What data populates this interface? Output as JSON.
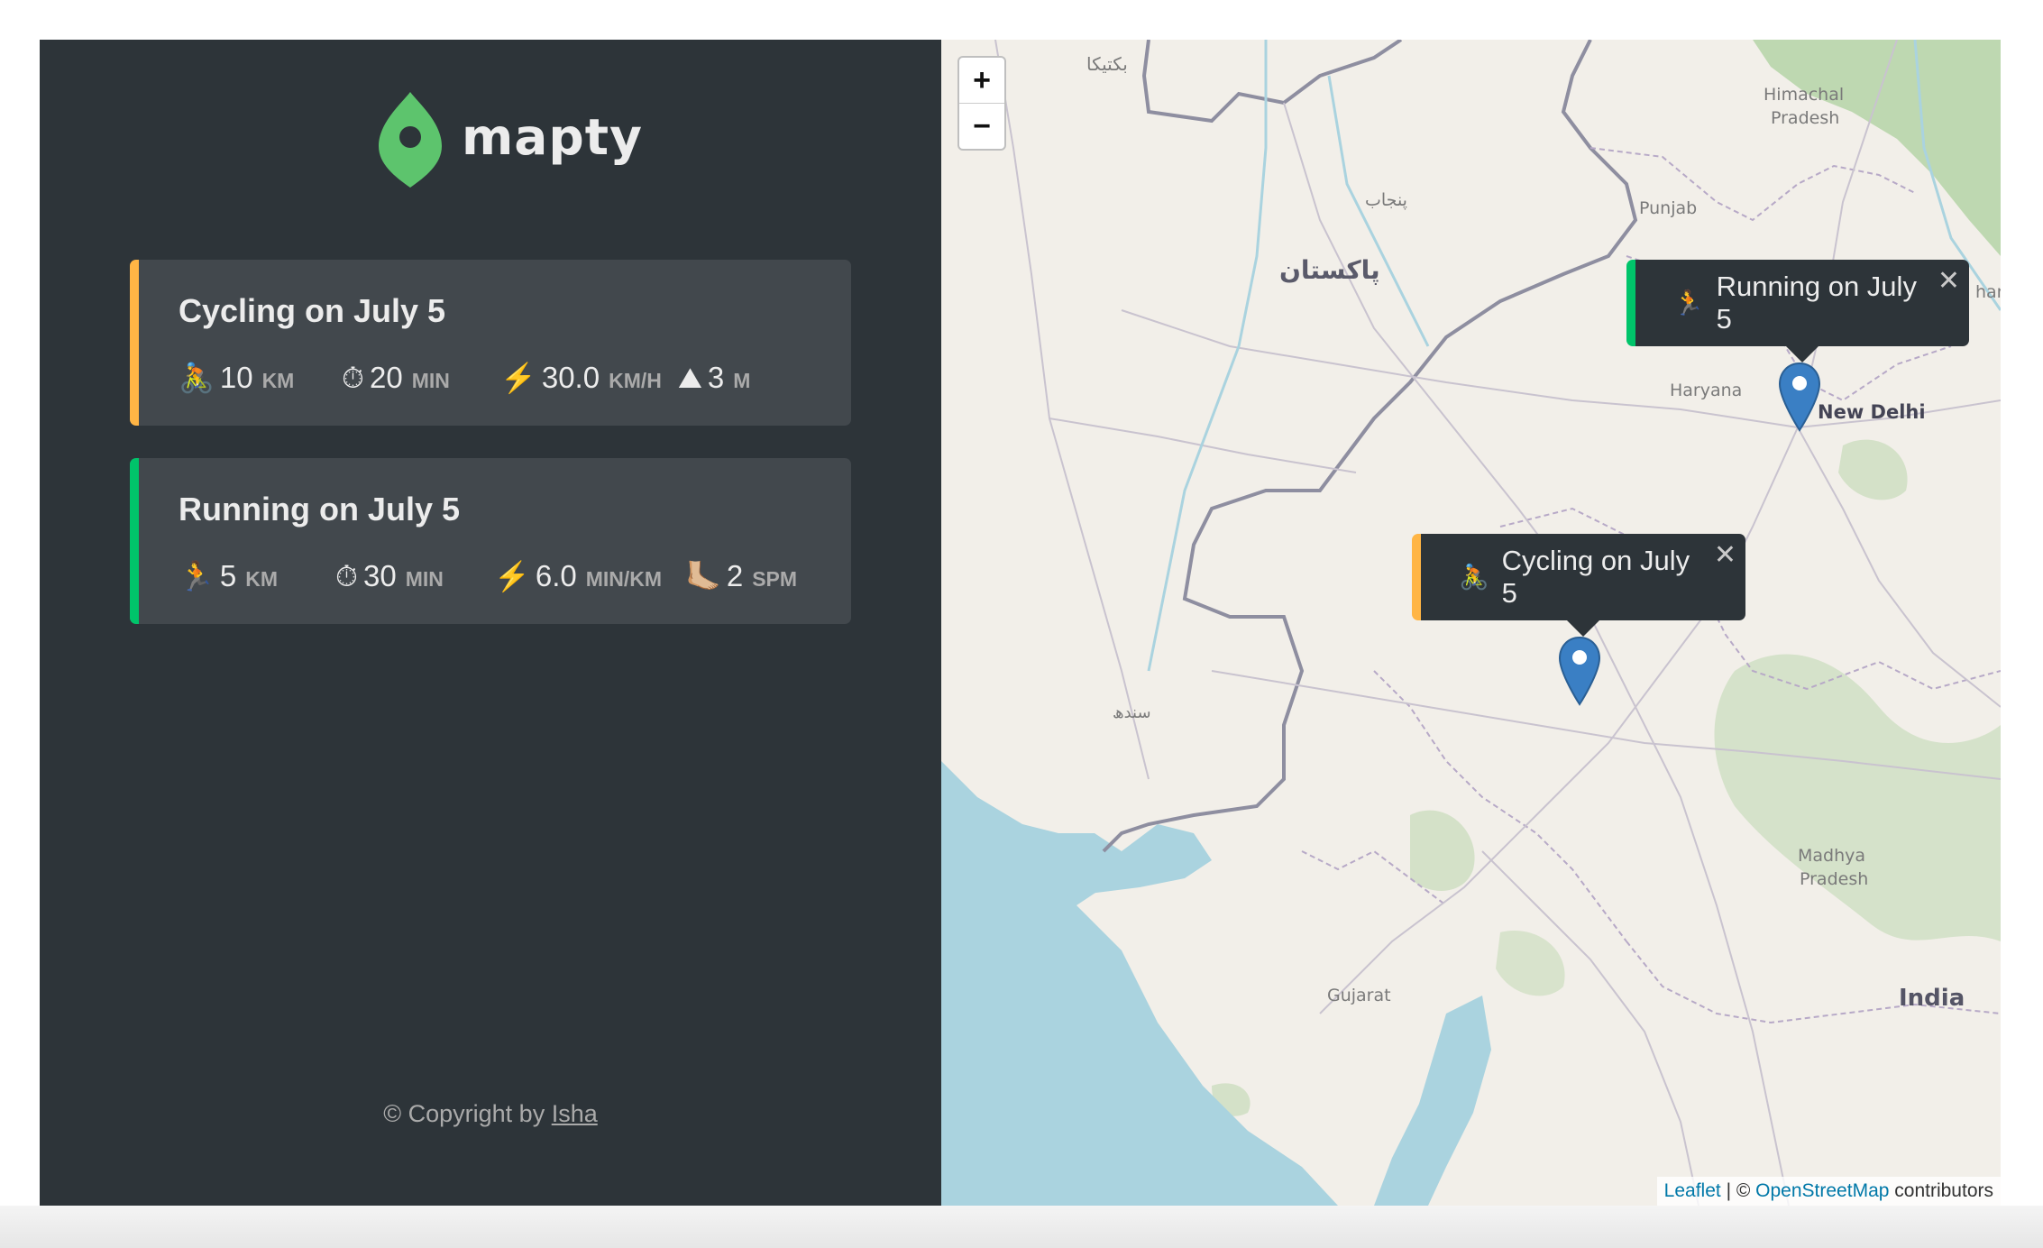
{
  "sidebar": {
    "logo_text": "mapty",
    "workouts": [
      {
        "type": "cycling",
        "title": "Cycling on July 5",
        "details": [
          {
            "icon": "🚴",
            "value": "10",
            "unit": "KM"
          },
          {
            "icon": "⏱",
            "value": "20",
            "unit": "MIN"
          },
          {
            "icon": "⚡️",
            "value": "30.0",
            "unit": "KM/H"
          },
          {
            "icon": "⛰",
            "value": "3",
            "unit": "M"
          }
        ]
      },
      {
        "type": "running",
        "title": "Running on July 5",
        "details": [
          {
            "icon": "🏃",
            "value": "5",
            "unit": "KM"
          },
          {
            "icon": "⏱",
            "value": "30",
            "unit": "MIN"
          },
          {
            "icon": "⚡️",
            "value": "6.0",
            "unit": "MIN/KM"
          },
          {
            "icon": "🦶🏼",
            "value": "2",
            "unit": "SPM"
          }
        ]
      }
    ],
    "copyright_prefix": "© Copyright by ",
    "copyright_author": "Isha"
  },
  "map": {
    "zoom_in": "+",
    "zoom_out": "−",
    "popups": [
      {
        "type": "running",
        "icon": "🏃",
        "text": "Running on July 5",
        "close": "✕"
      },
      {
        "type": "cycling",
        "icon": "🚴",
        "text": "Cycling on July 5",
        "close": "✕"
      }
    ],
    "labels": {
      "pakistan": "پاکستان",
      "punjab_ur": "پنجاب",
      "sindh": "سندھ",
      "balochistan": "بکتیکا",
      "himachal": "Himachal",
      "pradesh": "Pradesh",
      "punjab": "Punjab",
      "haryana": "Haryana",
      "new_delhi": "New Delhi",
      "madhya": "Madhya",
      "madhya_pradesh": "Pradesh",
      "gujarat": "Gujarat",
      "india": "India",
      "cutoff": "har"
    },
    "attribution": {
      "leaflet": "Leaflet",
      "separator": " | © ",
      "osm": "OpenStreetMap",
      "suffix": " contributors"
    },
    "colors": {
      "water": "#aad3df",
      "land": "#f2efe9",
      "forest": "#add19e",
      "border": "#8e8ea0",
      "marker": "#3a7fc4"
    }
  }
}
